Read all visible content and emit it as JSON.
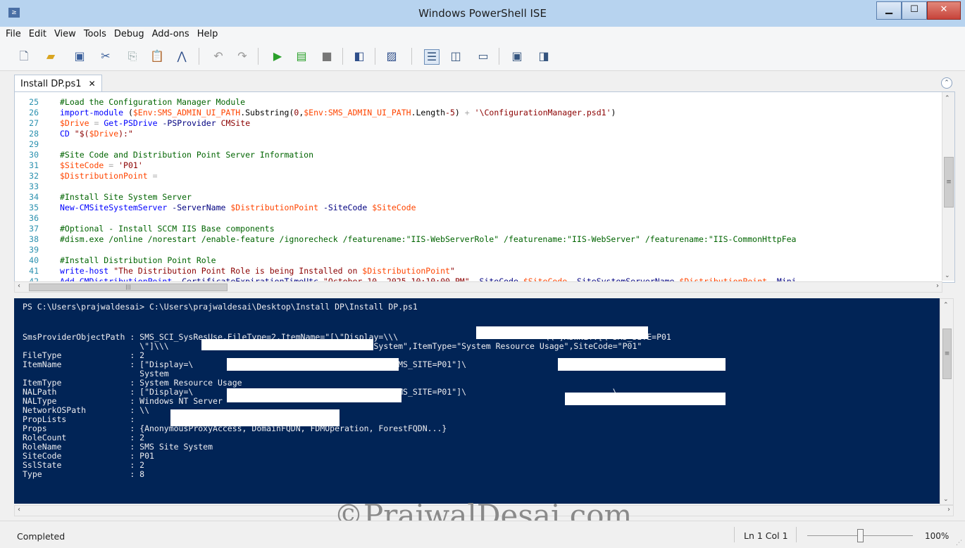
{
  "window": {
    "title": "Windows PowerShell ISE",
    "controls": [
      "minimize-icon",
      "maximize-icon",
      "close-icon"
    ]
  },
  "menu": [
    "File",
    "Edit",
    "View",
    "Tools",
    "Debug",
    "Add-ons",
    "Help"
  ],
  "toolbar": {
    "icons": [
      "new-file-icon",
      "open-file-icon",
      "save-icon",
      "cut-icon",
      "copy-icon",
      "paste-icon",
      "clear-console-icon",
      "undo-icon",
      "redo-icon",
      "run-script-icon",
      "run-selection-icon",
      "stop-icon",
      "new-remote-tab-icon",
      "start-powershell-icon",
      "show-script-pane-top-icon",
      "show-script-pane-right-icon",
      "show-script-pane-maximized-icon",
      "show-command-window-icon",
      "show-command-addon-icon"
    ]
  },
  "tab": {
    "label": "Install DP.ps1",
    "close": "✕"
  },
  "editor": {
    "lines": [
      {
        "n": "25",
        "parts": [
          [
            "c-comment",
            "#Load the Configuration Manager Module"
          ]
        ]
      },
      {
        "n": "26",
        "parts": [
          [
            "c-cmd",
            "import-module"
          ],
          [
            "c-plain",
            " ("
          ],
          [
            "c-var",
            "$Env:SMS_ADMIN_UI_PATH"
          ],
          [
            "c-plain",
            ".Substring("
          ],
          [
            "c-str",
            "0"
          ],
          [
            "c-plain",
            ","
          ],
          [
            "c-var",
            "$Env:SMS_ADMIN_UI_PATH"
          ],
          [
            "c-plain",
            ".Length"
          ],
          [
            "c-str",
            "-5"
          ],
          [
            "c-plain",
            ") "
          ],
          [
            "c-op",
            "+"
          ],
          [
            "c-plain",
            " "
          ],
          [
            "c-str",
            "'\\ConfigurationManager.psd1'"
          ],
          [
            "c-plain",
            ")"
          ]
        ]
      },
      {
        "n": "27",
        "parts": [
          [
            "c-var",
            "$Drive"
          ],
          [
            "c-plain",
            " "
          ],
          [
            "c-op",
            "="
          ],
          [
            "c-plain",
            " "
          ],
          [
            "c-cmd",
            "Get-PSDrive"
          ],
          [
            "c-plain",
            " "
          ],
          [
            "c-param",
            "-PSProvider"
          ],
          [
            "c-plain",
            " "
          ],
          [
            "c-str",
            "CMSite"
          ]
        ]
      },
      {
        "n": "28",
        "parts": [
          [
            "c-cmd",
            "CD"
          ],
          [
            "c-plain",
            " "
          ],
          [
            "c-str",
            "\"$("
          ],
          [
            "c-var",
            "$Drive"
          ],
          [
            "c-str",
            "):\""
          ]
        ]
      },
      {
        "n": "29",
        "parts": []
      },
      {
        "n": "30",
        "parts": [
          [
            "c-comment",
            "#Site Code and Distribution Point Server Information"
          ]
        ]
      },
      {
        "n": "31",
        "parts": [
          [
            "c-var",
            "$SiteCode"
          ],
          [
            "c-plain",
            " "
          ],
          [
            "c-op",
            "="
          ],
          [
            "c-plain",
            " "
          ],
          [
            "c-str",
            "'P01'"
          ]
        ]
      },
      {
        "n": "32",
        "parts": [
          [
            "c-var",
            "$DistributionPoint"
          ],
          [
            "c-plain",
            " "
          ],
          [
            "c-op",
            "="
          ]
        ]
      },
      {
        "n": "33",
        "parts": []
      },
      {
        "n": "34",
        "parts": [
          [
            "c-comment",
            "#Install Site System Server"
          ]
        ]
      },
      {
        "n": "35",
        "parts": [
          [
            "c-cmd",
            "New-CMSiteSystemServer"
          ],
          [
            "c-plain",
            " "
          ],
          [
            "c-param",
            "-ServerName"
          ],
          [
            "c-plain",
            " "
          ],
          [
            "c-var",
            "$DistributionPoint"
          ],
          [
            "c-plain",
            " "
          ],
          [
            "c-param",
            "-SiteCode"
          ],
          [
            "c-plain",
            " "
          ],
          [
            "c-var",
            "$SiteCode"
          ]
        ]
      },
      {
        "n": "36",
        "parts": []
      },
      {
        "n": "37",
        "parts": [
          [
            "c-comment",
            "#Optional - Install SCCM IIS Base components"
          ]
        ]
      },
      {
        "n": "38",
        "parts": [
          [
            "c-comment",
            "#dism.exe /online /norestart /enable-feature /ignorecheck /featurename:\"IIS-WebServerRole\" /featurename:\"IIS-WebServer\" /featurename:\"IIS-CommonHttpFea"
          ]
        ]
      },
      {
        "n": "39",
        "parts": []
      },
      {
        "n": "40",
        "parts": [
          [
            "c-comment",
            "#Install Distribution Point Role"
          ]
        ]
      },
      {
        "n": "41",
        "parts": [
          [
            "c-cmd",
            "write-host"
          ],
          [
            "c-plain",
            " "
          ],
          [
            "c-str",
            "\"The Distribution Point Role is being Installed on "
          ],
          [
            "c-var",
            "$DistributionPoint"
          ],
          [
            "c-str",
            "\""
          ]
        ]
      },
      {
        "n": "42",
        "parts": [
          [
            "c-cmd",
            "Add-CMDistributionPoint"
          ],
          [
            "c-plain",
            " "
          ],
          [
            "c-param",
            "-CertificateExpirationTimeUtc"
          ],
          [
            "c-plain",
            " "
          ],
          [
            "c-str",
            "\"October 10, 2025 10:10:00 PM\""
          ],
          [
            "c-plain",
            " "
          ],
          [
            "c-param",
            "-SiteCode"
          ],
          [
            "c-plain",
            " "
          ],
          [
            "c-var",
            "$SiteCode"
          ],
          [
            "c-plain",
            " "
          ],
          [
            "c-param",
            "-SiteSystemServerName"
          ],
          [
            "c-plain",
            " "
          ],
          [
            "c-var",
            "$DistributionPoint"
          ],
          [
            "c-plain",
            " "
          ],
          [
            "c-param",
            "-Mini"
          ]
        ]
      }
    ]
  },
  "console": {
    "lines": [
      "PS C:\\Users\\prajwaldesai> C:\\Users\\prajwaldesai\\Desktop\\Install DP\\Install DP.ps1",
      "",
      "",
      "SmsProviderObjectPath : SMS_SCI_SysResUse.FileType=2,ItemName=\"[\\\"Display=\\\\\\                              \\\\\"]MSWNET:[\\\"SMS_SITE=P01",
      "                        \\\"]\\\\\\                              \\\\,SMS Site System\",ItemType=\"System Resource Usage\",SiteCode=\"P01\"",
      "FileType              : 2",
      "ItemName              : [\"Display=\\                              \"]MSWNET:[\"SMS_SITE=P01\"]\\                              \\,SMS Site",
      "                        System",
      "ItemType              : System Resource Usage",
      "NALPath               : [\"Display=\\                              \"]MSWNET:[\"SMS_SITE=P01\"]\\                              \\",
      "NALType               : Windows NT Server",
      "NetworkOSPath         : \\\\",
      "PropLists             :",
      "Props                 : {AnonymousProxyAccess, DomainFQDN, FDMOperation, ForestFQDN...}",
      "RoleCount             : 2",
      "RoleName              : SMS Site System",
      "SiteCode              : P01",
      "SslState              : 2",
      "Type                  : 8"
    ]
  },
  "status": {
    "text": "Completed",
    "position": "Ln 1  Col 1",
    "zoom": "100%",
    "zoom_level": 0.5
  },
  "watermark": "©PrajwalDesai.com",
  "colors": {
    "console_bg": "#012456",
    "console_fg": "#eeedf0",
    "comment": "#006400",
    "variable": "#ff4500",
    "command": "#0000ff",
    "string": "#8b0000"
  }
}
